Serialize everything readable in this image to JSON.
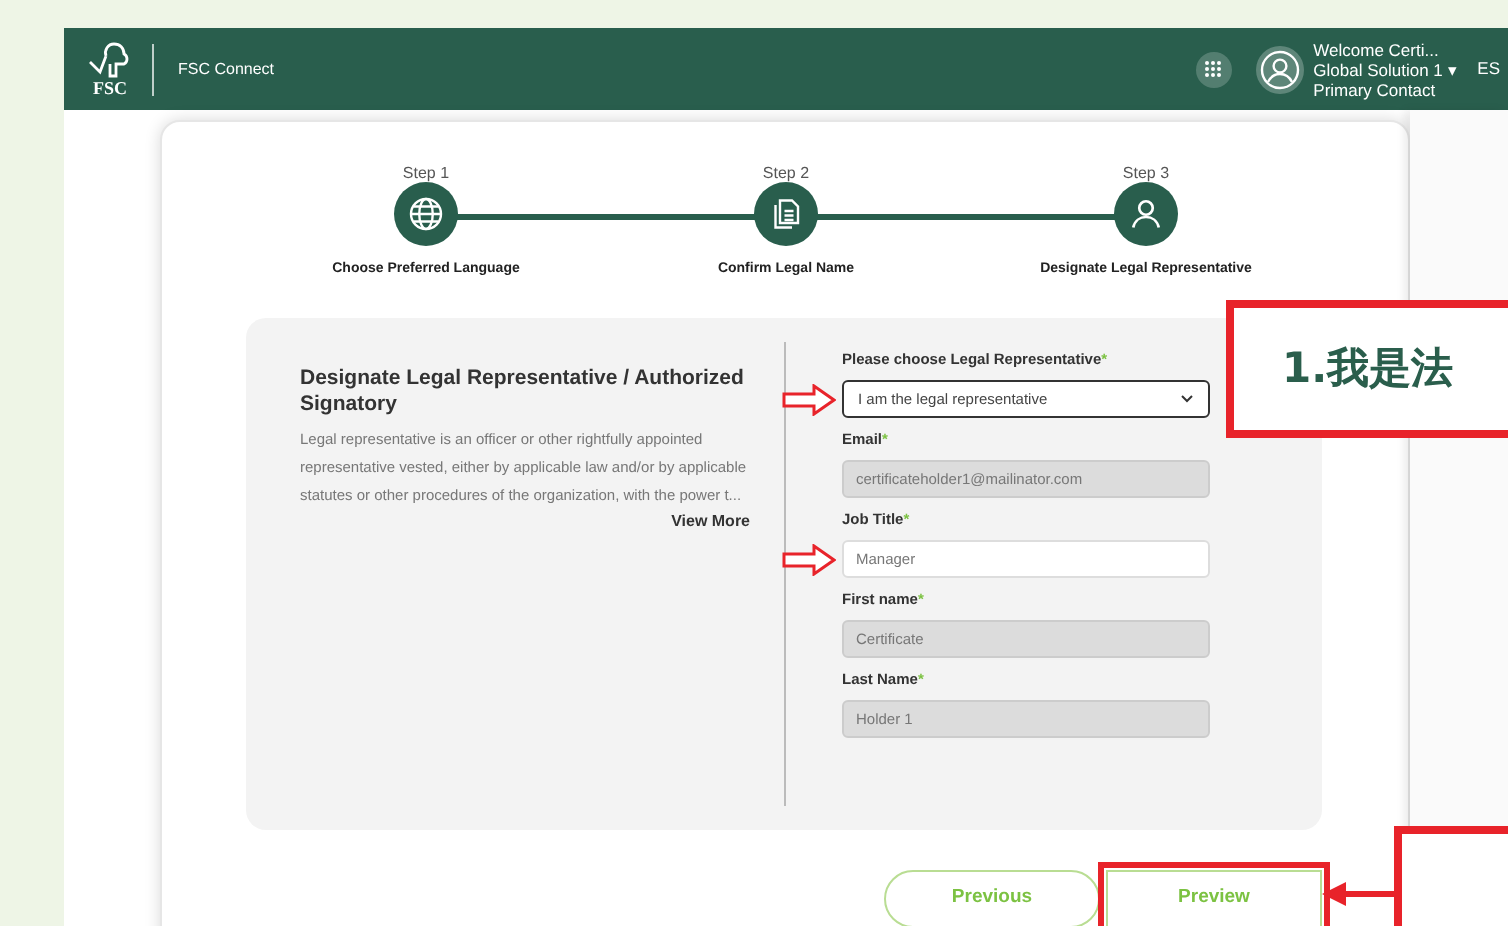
{
  "header": {
    "logo_text": "FSC",
    "app_name": "FSC Connect",
    "user_lines": [
      "Welcome Certi...",
      "Global Solution 1",
      "Primary Contact"
    ],
    "user_caret": "▾",
    "language": "ES"
  },
  "steps": [
    {
      "step_label": "Step 1",
      "title": "Choose Preferred Language",
      "kind": "globe"
    },
    {
      "step_label": "Step 2",
      "title": "Confirm Legal Name",
      "kind": "document"
    },
    {
      "step_label": "Step 3",
      "title": "Designate Legal Representative",
      "kind": "person"
    }
  ],
  "info": {
    "title": "Designate Legal Representative / Authorized Signatory",
    "description": "Legal representative is an officer or other rightfully appointed representative vested, either by applicable law and/or by applicable statutes or other procedures of the organization, with the power t...",
    "view_more": "View More"
  },
  "fields": [
    {
      "label": "Please choose Legal Representative",
      "required_mark": "*",
      "kind": "select",
      "value": "I am the legal representative",
      "disabled": false,
      "marked": true
    },
    {
      "label": "Email",
      "required_mark": "*",
      "kind": "input",
      "value": "certificateholder1@mailinator.com",
      "disabled": true,
      "marked": false
    },
    {
      "label": "Job Title",
      "required_mark": "*",
      "kind": "input",
      "value": "Manager",
      "disabled": false,
      "marked": true
    },
    {
      "label": "First name",
      "required_mark": "*",
      "kind": "input",
      "value": "Certificate",
      "disabled": true,
      "marked": false
    },
    {
      "label": "Last Name",
      "required_mark": "*",
      "kind": "input",
      "value": "Holder 1",
      "disabled": true,
      "marked": false
    }
  ],
  "buttons": [
    {
      "label": "Previous",
      "highlighted": false
    },
    {
      "label": "Preview",
      "highlighted": true
    }
  ],
  "callout": {
    "text": "1.我是法"
  }
}
